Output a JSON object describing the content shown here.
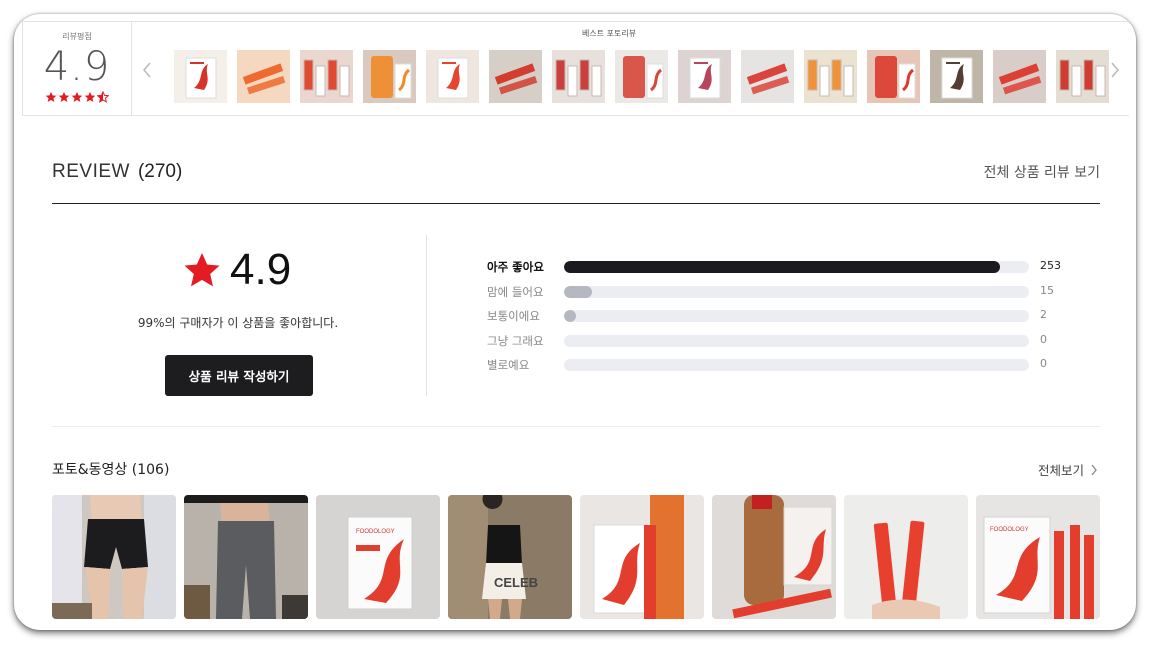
{
  "top": {
    "avg_label": "리뷰평점",
    "avg_score": "4.9",
    "best_photo_title": "베스트 포토리뷰",
    "thumbs": [
      {
        "bg": "#f4efe8",
        "fg": "#d9322b",
        "text": "FOODOLOGY Coleology Tea"
      },
      {
        "bg": "#f5d8c0",
        "fg": "#ef6a2e",
        "text": ""
      },
      {
        "bg": "#e9d7d0",
        "fg": "#e04a33",
        "text": ""
      },
      {
        "bg": "#d9c9bf",
        "fg": "#f08a27",
        "text": ""
      },
      {
        "bg": "#efe6e0",
        "fg": "#e5452f",
        "text": ""
      },
      {
        "bg": "#d5cfc8",
        "fg": "#d23d2f",
        "text": ""
      },
      {
        "bg": "#e7e0dc",
        "fg": "#c9403f",
        "text": ""
      },
      {
        "bg": "#ebe9e5",
        "fg": "#d7463a",
        "text": ""
      },
      {
        "bg": "#ddd3d2",
        "fg": "#b8455c",
        "text": ""
      },
      {
        "bg": "#e6e4e2",
        "fg": "#d9453b",
        "text": ""
      },
      {
        "bg": "#ece2d2",
        "fg": "#f0923a",
        "text": ""
      },
      {
        "bg": "#e8c6b6",
        "fg": "#da3b2c",
        "text": ""
      },
      {
        "bg": "#bfb6a8",
        "fg": "#553d33",
        "text": ""
      },
      {
        "bg": "#d9cdc9",
        "fg": "#dd3f35",
        "text": ""
      },
      {
        "bg": "#e4ddd3",
        "fg": "#cf3c32",
        "text": ""
      }
    ]
  },
  "review": {
    "heading_word": "REVIEW",
    "heading_count": "(270)",
    "all_reviews_link": "전체 상품 리뷰 보기",
    "score": "4.9",
    "satisfaction": "99%의 구매자가 이 상품을 좋아합니다.",
    "write_button": "상품 리뷰 작성하기",
    "distribution": [
      {
        "label": "아주 좋아요",
        "count": "253",
        "fraction": 0.937,
        "strong": true
      },
      {
        "label": "맘에 들어요",
        "count": "15",
        "fraction": 0.06,
        "strong": false
      },
      {
        "label": "보통이에요",
        "count": "2",
        "fraction": 0.025,
        "strong": false
      },
      {
        "label": "그냥 그래요",
        "count": "0",
        "fraction": 0,
        "strong": false
      },
      {
        "label": "별로예요",
        "count": "0",
        "fraction": 0,
        "strong": false
      }
    ]
  },
  "photos": {
    "title": "포토&동영상 (106)",
    "view_all": "전체보기",
    "items": [
      {
        "kind": "person-shorts",
        "bg": "#cfc8c2"
      },
      {
        "kind": "person-leggings",
        "bg": "#b9b2aa"
      },
      {
        "kind": "product-box",
        "bg": "#d6d4d2"
      },
      {
        "kind": "person-mirror",
        "bg": "#8a7a66"
      },
      {
        "kind": "product-bottle",
        "bg": "#e9e6e3"
      },
      {
        "kind": "product-bottle-sticks",
        "bg": "#dedbd8"
      },
      {
        "kind": "sticks-hand",
        "bg": "#ededec"
      },
      {
        "kind": "box-sticks",
        "bg": "#e7e5e3"
      }
    ]
  },
  "colors": {
    "star": "#e31b23",
    "bar_strong": "#1b1b1f",
    "bar_weak": "#b5b8c1",
    "track": "#ebedf3"
  },
  "icons": {
    "prev": "chevron-left-icon",
    "next": "chevron-right-icon",
    "star": "star-icon",
    "view_all": "chevron-right-icon"
  }
}
